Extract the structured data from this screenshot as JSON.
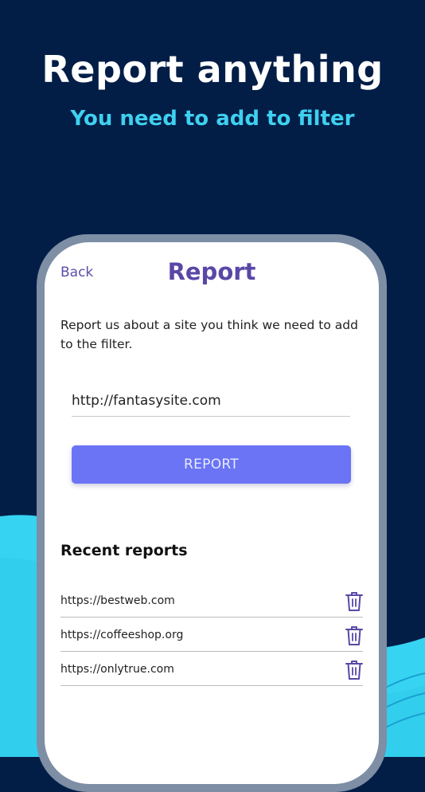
{
  "banner": {
    "headline": "Report anything",
    "subheadline": "You need to add to filter"
  },
  "screen": {
    "back_label": "Back",
    "title": "Report",
    "description": "Report us about a site you think we need to add to the filter.",
    "url_input_value": "http://fantasysite.com",
    "report_button_label": "REPORT",
    "recent_title": "Recent reports",
    "recent_reports": [
      {
        "url": "https://bestweb.com",
        "action_icon": "trash-icon"
      },
      {
        "url": "https://coffeeshop.org",
        "action_icon": "trash-icon"
      },
      {
        "url": "https://onlytrue.com",
        "action_icon": "trash-icon"
      }
    ]
  },
  "colors": {
    "background": "#021e47",
    "wave": "#3ad6f2",
    "headline": "#ffffff",
    "subheadline": "#3fd0f0",
    "accent_purple": "#5a47a6",
    "button": "#6a74f5",
    "phone_frame": "#7d8ea5"
  }
}
